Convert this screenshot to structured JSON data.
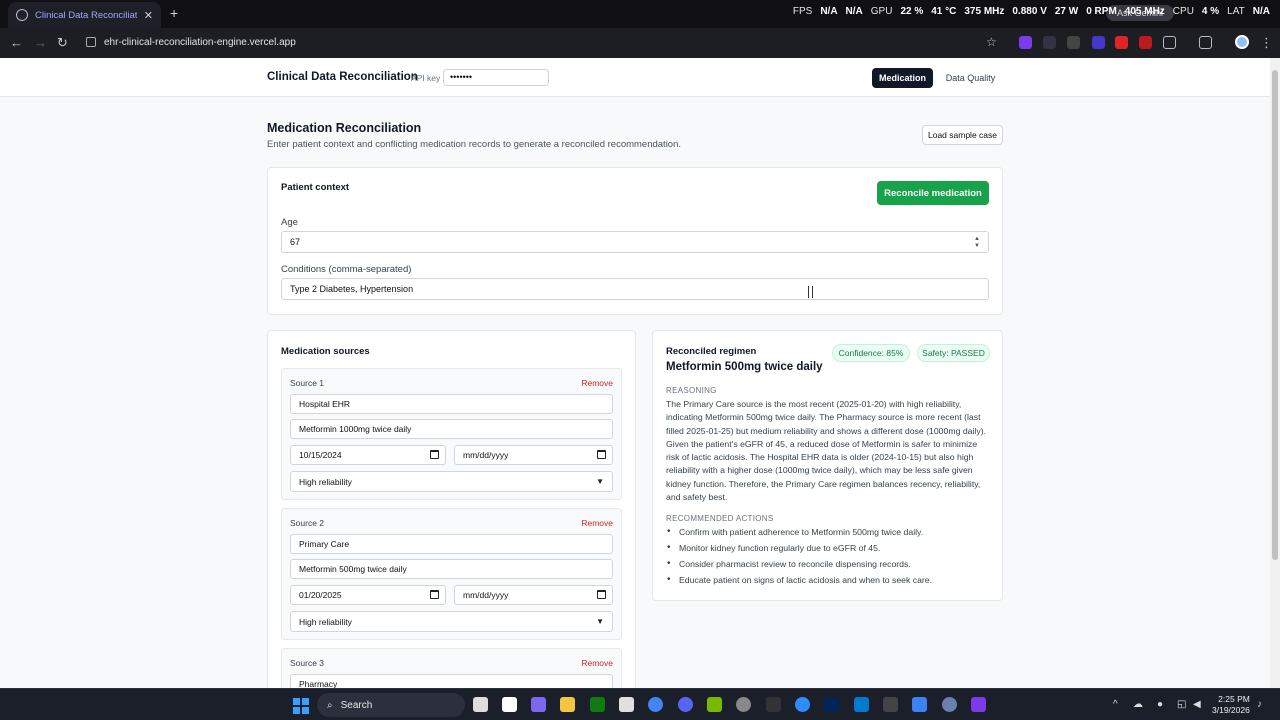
{
  "browser": {
    "tab_title": "Clinical Data Reconciliation Da",
    "url": "ehr-clinical-reconciliation-engine.vercel.app",
    "hud": {
      "fps_label": "FPS",
      "fps_v1": "N/A",
      "fps_v2": "N/A",
      "gpu_label": "GPU",
      "gpu_pct": "22 %",
      "gpu_temp": "41 °C",
      "gpu_clock": "375 MHz",
      "gpu_volt": "0.880 V",
      "gpu_power": "27 W",
      "rpm": "0 RPM",
      "mem_clock": "405 MHz",
      "cpu_label": "CPU",
      "cpu_pct": "4 %",
      "lat_label": "LAT",
      "lat_value": "N/A",
      "ask_gemini": "Ask Gemini"
    }
  },
  "app": {
    "brand": "Clinical Data Reconciliation",
    "api_key_label": "API key",
    "api_key_value": "•••••••",
    "nav_medication": "Medication",
    "nav_data_quality": "Data Quality"
  },
  "page": {
    "title": "Medication Reconciliation",
    "subtitle": "Enter patient context and conflicting medication records to generate a reconciled recommendation.",
    "load_sample": "Load sample case"
  },
  "patient": {
    "title": "Patient context",
    "reconcile_button": "Reconcile medication",
    "age_label": "Age",
    "age_value": "67",
    "conditions_label": "Conditions (comma-separated)",
    "conditions_value": "Type 2 Diabetes, Hypertension"
  },
  "sources": {
    "title": "Medication sources",
    "remove_label": "Remove",
    "date_placeholder": "mm/dd/yyyy",
    "items": [
      {
        "label": "Source 1",
        "system": "Hospital EHR",
        "medication": "Metformin 1000mg twice daily",
        "date": "10/15/2024",
        "reliability": "High reliability"
      },
      {
        "label": "Source 2",
        "system": "Primary Care",
        "medication": "Metformin 500mg twice daily",
        "date": "01/20/2025",
        "reliability": "High reliability"
      },
      {
        "label": "Source 3",
        "system": "Pharmacy"
      }
    ]
  },
  "result": {
    "title": "Reconciled regimen",
    "confidence": "Confidence: 85%",
    "safety": "Safety: PASSED",
    "regimen": "Metformin 500mg twice daily",
    "reasoning_label": "REASONING",
    "reasoning": "The Primary Care source is the most recent (2025-01-20) with high reliability, indicating Metformin 500mg twice daily. The Pharmacy source is more recent (last filled 2025-01-25) but medium reliability and shows a different dose (1000mg daily). Given the patient's eGFR of 45, a reduced dose of Metformin is safer to minimize risk of lactic acidosis. The Hospital EHR data is older (2024-10-15) but also high reliability with a higher dose (1000mg twice daily), which may be less safe given kidney function. Therefore, the Primary Care regimen balances recency, reliability, and safety best.",
    "actions_label": "RECOMMENDED ACTIONS",
    "actions": [
      "Confirm with patient adherence to Metformin 500mg twice daily.",
      "Monitor kidney function regularly due to eGFR of 45.",
      "Consider pharmacist review to reconcile dispensing records.",
      "Educate patient on signs of lactic acidosis and when to seek care."
    ]
  },
  "taskbar": {
    "search": "Search",
    "time": "2:25 PM",
    "date": "3/19/2026"
  }
}
